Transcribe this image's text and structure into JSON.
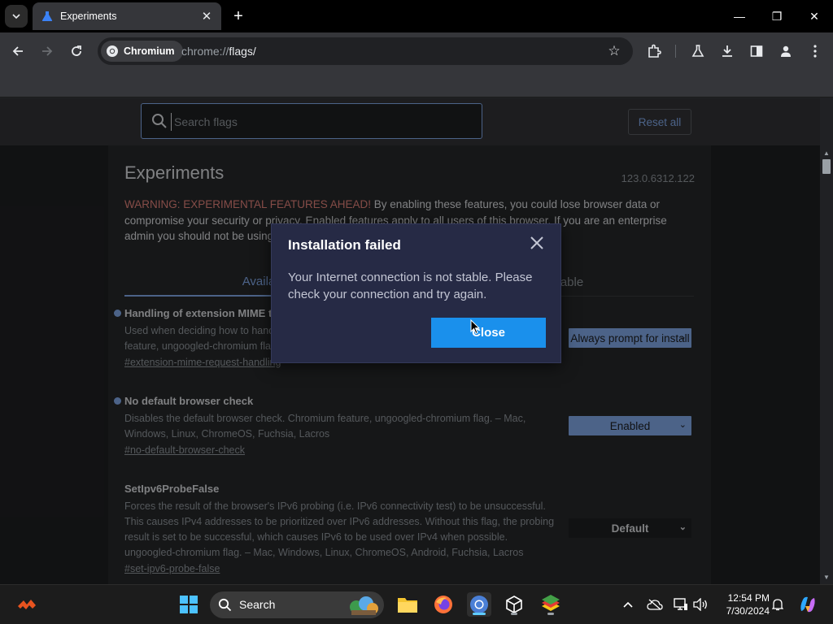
{
  "window": {
    "tab_title": "Experiments",
    "minimize_glyph": "—",
    "restore_glyph": "❐",
    "close_glyph": "✕"
  },
  "toolbar": {
    "chip_label": "Chromium",
    "url_scheme": "chrome://",
    "url_path": "flags/"
  },
  "header": {
    "search_placeholder": "Search flags",
    "reset_label": "Reset all"
  },
  "page": {
    "title": "Experiments",
    "version": "123.0.6312.122",
    "warning_prefix": "WARNING: EXPERIMENTAL FEATURES AHEAD!",
    "warning_text": " By enabling these features, you could lose browser data or compromise your security or privacy. Enabled features apply to all users of this browser. If you are an enterprise admin you should not be using these flags in production.",
    "tab_available": "Available",
    "tab_unavailable": "Unavailable"
  },
  "flags": [
    {
      "name": "Handling of extension MIME type requests",
      "description": "Used when deciding how to handle a request for a CRX or user script MIME type. Chromium feature, ungoogled-chromium flag. – Mac, Windows, Linux, ChromeOS, Fuchsia, Lacros",
      "link": "#extension-mime-request-handling",
      "value": "Always prompt for install"
    },
    {
      "name": "No default browser check",
      "description": "Disables the default browser check. Chromium feature, ungoogled-chromium flag. – Mac, Windows, Linux, ChromeOS, Fuchsia, Lacros",
      "link": "#no-default-browser-check",
      "value": "Enabled"
    },
    {
      "name": "SetIpv6ProbeFalse",
      "description": "Forces the result of the browser's IPv6 probing (i.e. IPv6 connectivity test) to be unsuccessful. This causes IPv4 addresses to be prioritized over IPv6 addresses. Without this flag, the probing result is set to be successful, which causes IPv6 to be used over IPv4 when possible. ungoogled-chromium flag. – Mac, Windows, Linux, ChromeOS, Android, Fuchsia, Lacros",
      "link": "#set-ipv6-probe-false",
      "value": "Default"
    }
  ],
  "dialog": {
    "title": "Installation failed",
    "message": "Your Internet connection is not stable. Please check your connection and try again.",
    "button": "Close"
  },
  "taskbar": {
    "search_label": "Search",
    "time": "12:54 PM",
    "date": "7/30/2024"
  },
  "colors": {
    "accent": "#8ab4f8",
    "warning": "#f28b82",
    "dialog_button": "#1a90ec"
  }
}
